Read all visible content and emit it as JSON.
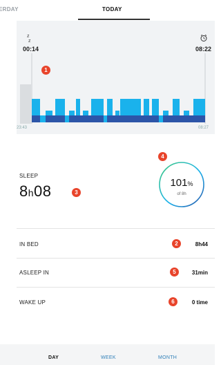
{
  "tabs": {
    "previous": "ERDAY",
    "current": "TODAY"
  },
  "chart": {
    "sleep_start": "00:14",
    "wake_time": "08:22",
    "axis_start": "23:43",
    "axis_end": "08:27",
    "colors": {
      "light": "#1ab2ec",
      "deep": "#2c55a8",
      "awake": "#dadde0",
      "background": "#f1f3f5"
    }
  },
  "markers": {
    "m1": "1",
    "m2": "2",
    "m3": "3",
    "m4": "4",
    "m5": "5",
    "m6": "6"
  },
  "sleep": {
    "label": "SLEEP",
    "hours": "8",
    "hours_unit": "h",
    "minutes": "08"
  },
  "goal": {
    "percent": "101",
    "percent_sign": "%",
    "subtitle": "of 8h",
    "progress": 1.01
  },
  "rows": [
    {
      "label": "IN BED",
      "value": "8h44"
    },
    {
      "label": "ASLEEP IN",
      "value": "31min"
    },
    {
      "label": "WAKE UP",
      "value": "0 time"
    }
  ],
  "nav": {
    "day": "DAY",
    "week": "WEEK",
    "month": "MONTH"
  }
}
